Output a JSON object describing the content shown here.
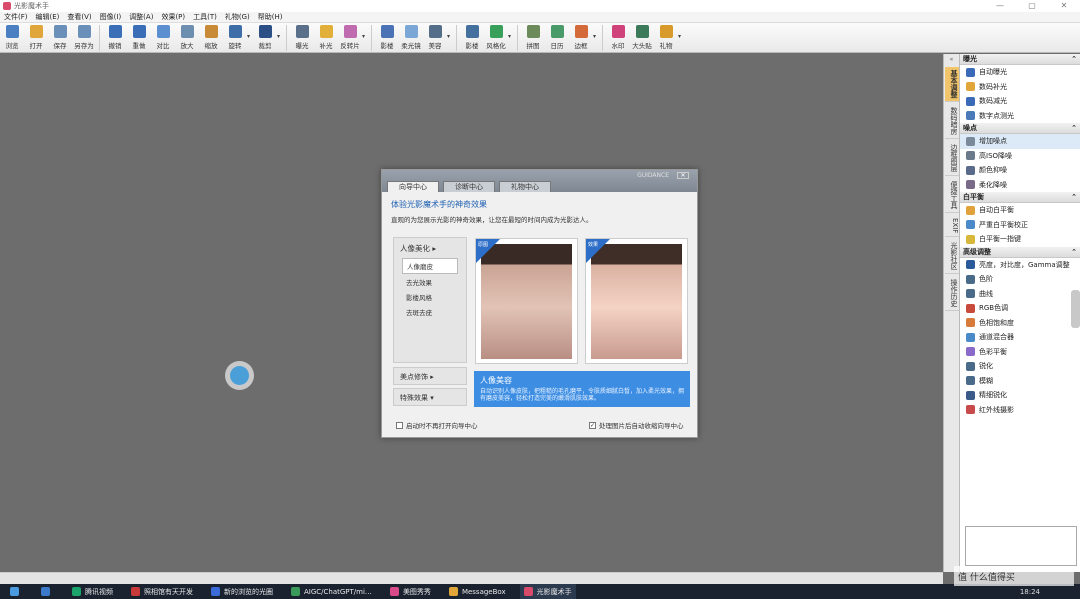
{
  "app": {
    "title": "光影魔术手",
    "window_controls": [
      "—",
      "▢",
      "✕"
    ]
  },
  "menu": [
    "文件(F)",
    "编辑(E)",
    "查看(V)",
    "图像(I)",
    "调整(A)",
    "效果(P)",
    "工具(T)",
    "礼物(G)",
    "帮助(H)"
  ],
  "toolbar": [
    {
      "label": "浏览",
      "color": "#4a7fc1"
    },
    {
      "label": "打开",
      "color": "#e0a63a"
    },
    {
      "label": "保存",
      "color": "#6a8fb8"
    },
    {
      "label": "另存为",
      "color": "#6a8fb8"
    },
    {
      "sep": true
    },
    {
      "label": "撤销",
      "color": "#3a6fb7"
    },
    {
      "label": "重做",
      "color": "#3a6fb7"
    },
    {
      "label": "对比",
      "color": "#5b8fcf"
    },
    {
      "label": "放大",
      "color": "#6c8fb0"
    },
    {
      "label": "缩放",
      "color": "#c88a36"
    },
    {
      "label": "旋转",
      "color": "#3d6ea8",
      "dd": true
    },
    {
      "label": "裁剪",
      "color": "#2c4f86",
      "dd": true
    },
    {
      "sep": true
    },
    {
      "label": "曝光",
      "color": "#5a6f8a"
    },
    {
      "label": "补光",
      "color": "#e2b038"
    },
    {
      "label": "反转片",
      "color": "#c06ab0",
      "dd": true
    },
    {
      "sep": true
    },
    {
      "label": "影楼",
      "color": "#4a72b4"
    },
    {
      "label": "柔光镜",
      "color": "#7aa7d6"
    },
    {
      "label": "美容",
      "color": "#546e8a",
      "dd": true
    },
    {
      "sep": true
    },
    {
      "label": "影楼",
      "color": "#44709e"
    },
    {
      "label": "风格化",
      "color": "#38a05a",
      "dd": true
    },
    {
      "sep": true
    },
    {
      "label": "拼图",
      "color": "#6c8a5a"
    },
    {
      "label": "日历",
      "color": "#4a9b6a"
    },
    {
      "label": "边框",
      "color": "#d46a3a",
      "dd": true
    },
    {
      "sep": true
    },
    {
      "label": "水印",
      "color": "#d0437a"
    },
    {
      "label": "大头贴",
      "color": "#3d7a5a"
    },
    {
      "label": "礼物",
      "color": "#d89a2a",
      "dd": true
    }
  ],
  "vtabs": [
    "基本调整",
    "数码暗房",
    "边框图层",
    "便捷工具",
    "EXIF",
    "光影社区",
    "操作历史"
  ],
  "panel": [
    {
      "header": "曝光",
      "items": [
        {
          "label": "自动曝光",
          "color": "#3a6ab8"
        },
        {
          "label": "数码补光",
          "color": "#e0a63a"
        },
        {
          "label": "数码减光",
          "color": "#3a6ab8"
        },
        {
          "label": "数字点测光",
          "color": "#4a7ab8"
        }
      ]
    },
    {
      "header": "噪点",
      "items": [
        {
          "label": "增加噪点",
          "color": "#7a8a9a"
        },
        {
          "label": "高ISO降噪",
          "color": "#6a7a8a"
        },
        {
          "label": "颜色抑噪",
          "color": "#5a6a8a"
        },
        {
          "label": "柔化降噪",
          "color": "#7a6a8a"
        }
      ]
    },
    {
      "header": "白平衡",
      "items": [
        {
          "label": "自动白平衡",
          "color": "#e2a23a"
        },
        {
          "label": "严重白平衡校正",
          "color": "#4a8ac8"
        },
        {
          "label": "白平衡一指键",
          "color": "#d8b83a"
        }
      ]
    },
    {
      "header": "高级调整",
      "items": [
        {
          "label": "亮度，对比度，Gamma调整",
          "color": "#2a5a9a"
        },
        {
          "label": "色阶",
          "color": "#4a6a8a"
        },
        {
          "label": "曲线",
          "color": "#4a6a8a"
        },
        {
          "label": "RGB色调",
          "color": "#c84a3a"
        },
        {
          "label": "色相饱和度",
          "color": "#d87a3a"
        },
        {
          "label": "通道混合器",
          "color": "#4a8ac8"
        },
        {
          "label": "色彩平衡",
          "color": "#8a6ac8"
        },
        {
          "label": "锐化",
          "color": "#4a6a8a"
        },
        {
          "label": "模糊",
          "color": "#4a6a8a"
        },
        {
          "label": "精细锐化",
          "color": "#3a5a8a"
        },
        {
          "label": "红外线摄影",
          "color": "#c84a4a"
        }
      ]
    }
  ],
  "dialog": {
    "tabs": [
      "向导中心",
      "诊断中心",
      "礼物中心"
    ],
    "brand": "GUIDANCE",
    "close": "✕",
    "title": "体验光影魔术手的神奇效果",
    "subtitle": "直观的为您展示光影的神奇效果，让您在最短的时间内成为光影达人。",
    "menu_header": "人像美化 ▸",
    "menu_items": [
      "人像磨皮",
      "去光效果",
      "影楼风格",
      "去斑去疣"
    ],
    "extra1": "美点修饰 ▸",
    "extra2": "特殊效果 ▾",
    "ribbon_before": "原图",
    "ribbon_after": "效果",
    "info_title": "人像美容",
    "info_text": "自动识别人像皮肤，把粗糙的毛孔磨平，令肤质细腻白皙，加入柔光效果，拥有磨皮美容，轻松打造完美的嫩滑肌肤效果。",
    "chk_left": "启动时不再打开向导中心",
    "chk_right": "处理图片后自动收缩向导中心",
    "chk_right_mark": "✓"
  },
  "taskbar": [
    {
      "label": "腾讯视频",
      "color": "#1aa36a"
    },
    {
      "label": "照相馆有天开发",
      "color": "#c83a3a"
    },
    {
      "label": "新的浏览的光圈",
      "color": "#3a6ad8"
    },
    {
      "label": "AIGC/ChatGPT/mi…",
      "color": "#3a9a5a"
    },
    {
      "label": "美图秀秀",
      "color": "#d84a8a"
    },
    {
      "label": "MessageBox",
      "color": "#e0a63a"
    },
    {
      "label": "光影魔术手",
      "color": "#d84a6a",
      "active": true
    }
  ],
  "tray": {
    "time": "18:24"
  },
  "watermark": "值 什么值得买"
}
